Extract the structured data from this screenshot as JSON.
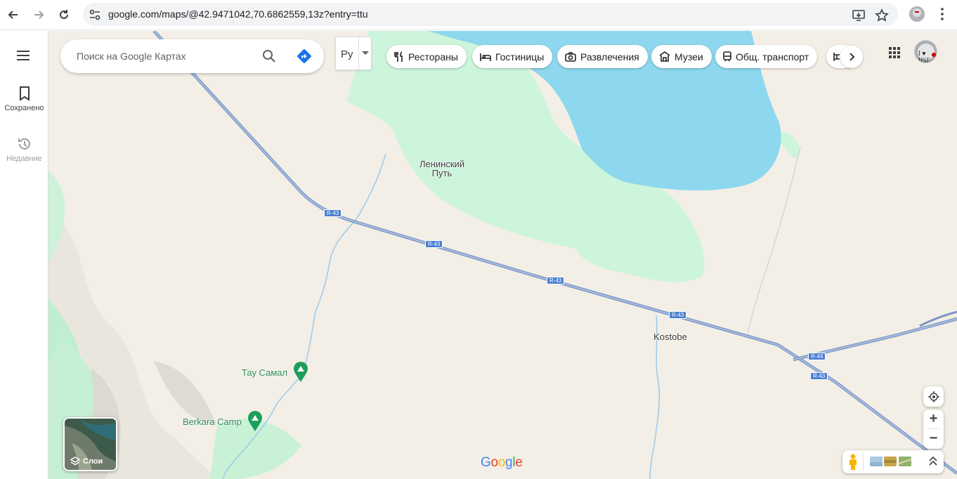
{
  "browser": {
    "url": "google.com/maps/@42.9471042,70.6862559,13z?entry=ttu",
    "icons": [
      "back-arrow-icon",
      "forward-arrow-icon",
      "reload-icon",
      "site-settings-icon",
      "install-app-icon",
      "bookmark-star-icon",
      "more-vertical-icon"
    ]
  },
  "sidebar": {
    "items": [
      {
        "label": "Сохранено",
        "icon": "bookmark-icon",
        "enabled": true
      },
      {
        "label": "Недавние",
        "icon": "history-icon",
        "enabled": false
      }
    ]
  },
  "search": {
    "placeholder": "Поиск на Google Картах"
  },
  "language_button": {
    "label": "Ру"
  },
  "categories": [
    {
      "label": "Рестораны",
      "icon": "restaurant-icon"
    },
    {
      "label": "Гостиницы",
      "icon": "hotel-icon"
    },
    {
      "label": "Развлечения",
      "icon": "camera-icon"
    },
    {
      "label": "Музеи",
      "icon": "museum-icon"
    },
    {
      "label": "Общ. транспорт",
      "icon": "transit-icon"
    }
  ],
  "account": {
    "avatar_text": "I ♥ HSE"
  },
  "map": {
    "places": [
      {
        "id": "leninsky",
        "name": "Ленинский Путь"
      },
      {
        "id": "kostobe",
        "name": "Kostobe"
      }
    ],
    "pois": [
      {
        "name": "Тау Самал",
        "icon": "campground-icon"
      },
      {
        "name": "Berkara Camp",
        "icon": "campground-icon"
      }
    ],
    "road_shields": [
      "R-43",
      "R-43",
      "R-43",
      "R-43",
      "R-43",
      "R-44"
    ],
    "colors": {
      "land": "#f3efe6",
      "park": "#cdf5dc",
      "water": "#8dd8ee",
      "road": "#8fa7cf"
    }
  },
  "layers_button": {
    "label": "Слои"
  },
  "logo": {
    "text": "Google"
  }
}
